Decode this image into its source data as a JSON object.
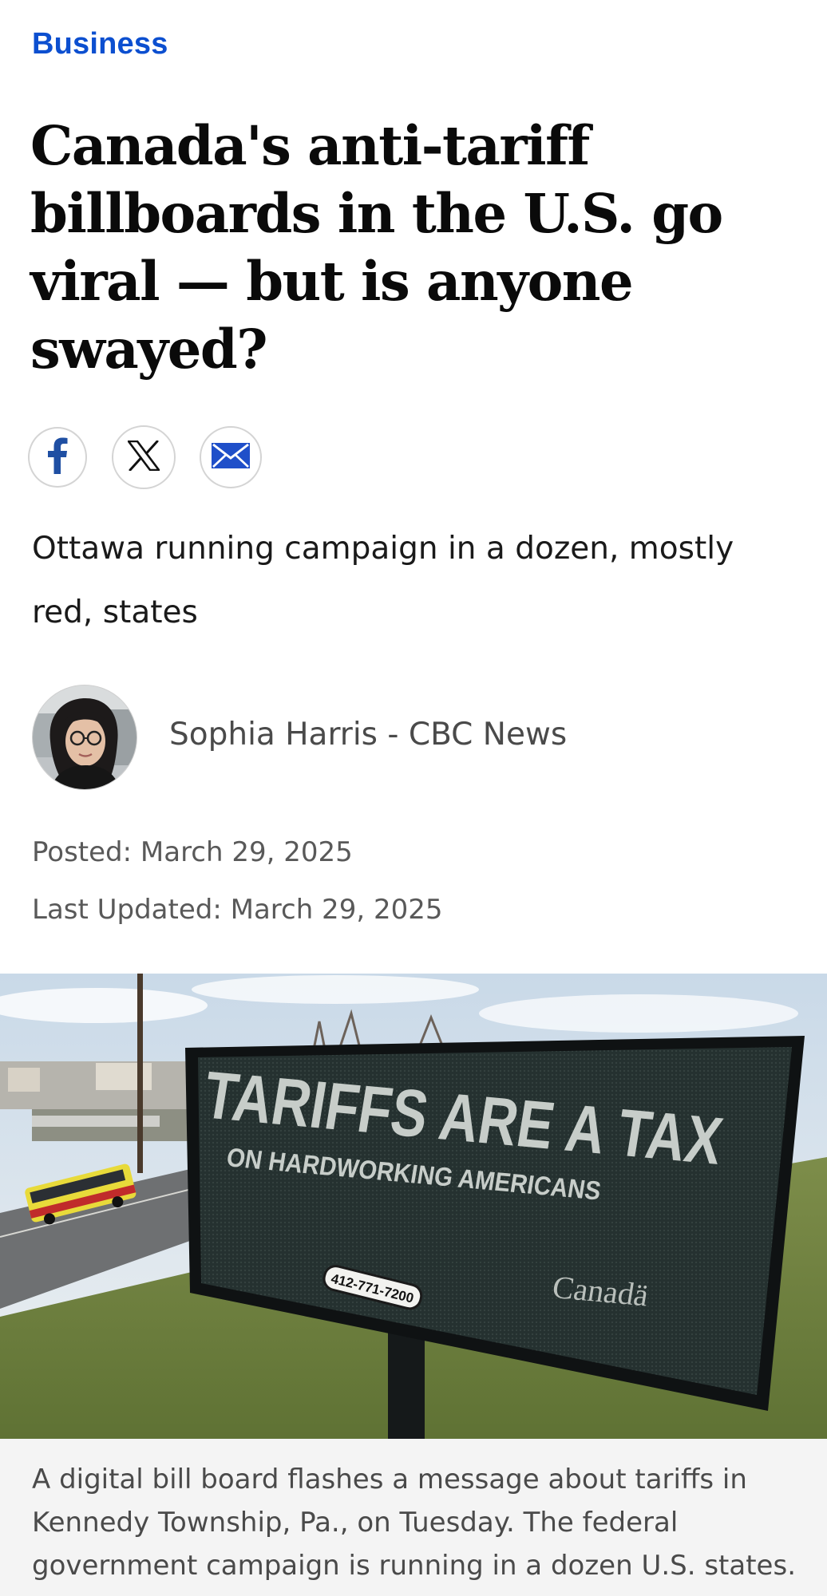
{
  "section": {
    "label": "Business"
  },
  "article": {
    "headline": "Canada's anti-tariff billboards in the U.S. go viral — but is anyone swayed?",
    "deck": "Ottawa running campaign in a dozen, mostly red, states",
    "byline": "Sophia Harris - CBC News",
    "posted": "Posted: March 29, 2025",
    "updated": "Last Updated: March 29, 2025",
    "caption": "A digital bill board flashes a message about tariffs in Kennedy Township, Pa., on Tuesday. The federal government campaign is running in a dozen U.S. states. (Gene J. Puskar/The Associated Press)"
  },
  "share": {
    "items": [
      {
        "name": "facebook",
        "icon": "facebook-icon"
      },
      {
        "name": "x",
        "icon": "x-icon"
      },
      {
        "name": "email",
        "icon": "mail-icon"
      }
    ]
  },
  "billboard": {
    "line1": "TARIFFS ARE A TAX",
    "line2": "ON HARDWORKING AMERICANS",
    "brand": "Canadä",
    "phone": "412-771-7200"
  },
  "colors": {
    "accent": "#0c4fd0",
    "text": "#0a0a0a",
    "muted": "#595959",
    "caption_bg": "#f4f4f4"
  }
}
